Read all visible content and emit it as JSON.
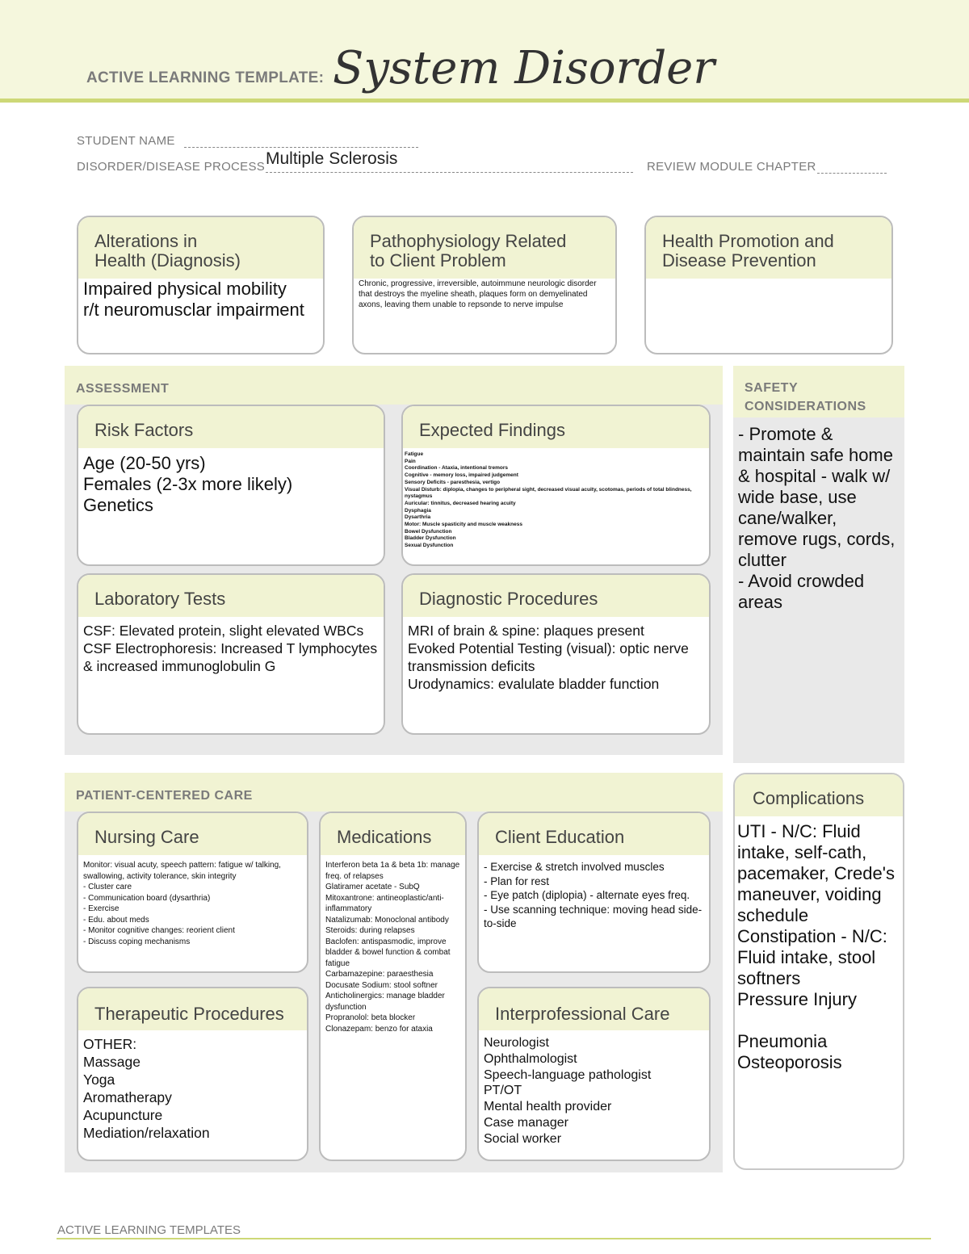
{
  "header": {
    "template_label": "ACTIVE LEARNING TEMPLATE:",
    "title": "System Disorder"
  },
  "fields": {
    "student_name_label": "STUDENT NAME",
    "student_name": "",
    "disorder_label": "DISORDER/DISEASE PROCESS",
    "disorder": "Multiple Sclerosis",
    "review_label": "REVIEW MODULE CHAPTER",
    "review": ""
  },
  "top": {
    "alterations": {
      "title": "Alterations in\nHealth (Diagnosis)",
      "body": "Impaired physical mobility\nr/t neuromusclar impairment"
    },
    "patho": {
      "title": "Pathophysiology Related\nto Client Problem",
      "body": "Chronic, progressive, irreversible, autoimmune neurologic disorder that destroys the myeline sheath, plaques form on demyelinated axons, leaving them unable to repsonde to nerve impulse"
    },
    "health": {
      "title": "Health Promotion and\nDisease Prevention",
      "body": ""
    }
  },
  "assessment": {
    "label": "ASSESSMENT",
    "risk": {
      "title": "Risk Factors",
      "body": "Age (20-50 yrs)\nFemales (2-3x more likely)\nGenetics"
    },
    "findings": {
      "title": "Expected Findings",
      "body": "Fatigue\nPain\nCoordination - Ataxia, intentional tremors\nCognitive - memory loss, impaired judgement\nSensory Deficits - paresthesia, vertigo\nVisual Disturb: diplopia, changes to peripheral sight, decreased visual acuity, scotomas, periods of total blindness, nystagmus\nAuricular: tinnitus, decreased hearing acuity\nDysphagia\nDysarthria\nMotor: Muscle spasticity and muscle weakness\nBowel Dysfunction\nBladder Dysfunction\nSexual Dysfunction"
    },
    "labs": {
      "title": "Laboratory Tests",
      "body": "CSF:  Elevated protein, slight elevated WBCs\nCSF Electrophoresis: Increased T lymphocytes & increased immunoglobulin G"
    },
    "diag": {
      "title": "Diagnostic Procedures",
      "body": "MRI of brain & spine: plaques present\nEvoked Potential Testing (visual): optic nerve transmission deficits\nUrodynamics: evalulate bladder function"
    }
  },
  "safety": {
    "label": "SAFETY\nCONSIDERATIONS",
    "body": "- Promote & maintain safe home & hospital - walk w/ wide base, use cane/walker, remove rugs, cords, clutter\n- Avoid crowded areas"
  },
  "pcc": {
    "label": "PATIENT-CENTERED CARE",
    "nursing": {
      "title": "Nursing Care",
      "body": "Monitor: visual acuty, speech pattern: fatigue w/ talking, swallowing, activity tolerance, skin integrity\n- Cluster care\n- Communication board (dysarthria)\n- Exercise\n- Edu. about meds\n- Monitor cognitive changes: reorient client\n- Discuss coping mechanisms"
    },
    "meds": {
      "title": "Medications",
      "body": "Interferon beta 1a & beta 1b: manage freq. of relapses\nGlatiramer acetate - SubQ\nMitoxantrone: antineoplastic/anti-inflammatory\nNatalizumab: Monoclonal antibody\nSteroids: during relapses\nBaclofen: antispasmodic, improve bladder & bowel function & combat fatigue\nCarbamazepine: paraesthesia\nDocusate Sodium: stool softner\nAnticholinergics: manage bladder dysfunction\nPropranolol: beta blocker\nClonazepam: benzo for ataxia"
    },
    "education": {
      "title": "Client Education",
      "body": "- Exercise & stretch involved muscles\n- Plan for rest\n- Eye patch (diplopia) - alternate eyes freq.\n- Use scanning technique: moving head side-to-side"
    },
    "therapeutic": {
      "title": "Therapeutic Procedures",
      "body": "OTHER:\nMassage\nYoga\nAromatherapy\nAcupuncture\nMediation/relaxation"
    },
    "interprof": {
      "title": "Interprofessional Care",
      "body": "Neurologist\nOphthalmologist\nSpeech-language pathologist\nPT/OT\nMental health provider\nCase manager\nSocial worker"
    }
  },
  "complications": {
    "title": "Complications",
    "body": "UTI - N/C: Fluid intake, self-cath, pacemaker, Crede's maneuver, voiding schedule\nConstipation - N/C: Fluid intake, stool softners\nPressure Injury\n\nPneumonia\nOsteoporosis"
  },
  "footer": {
    "label": "ACTIVE LEARNING TEMPLATES"
  }
}
